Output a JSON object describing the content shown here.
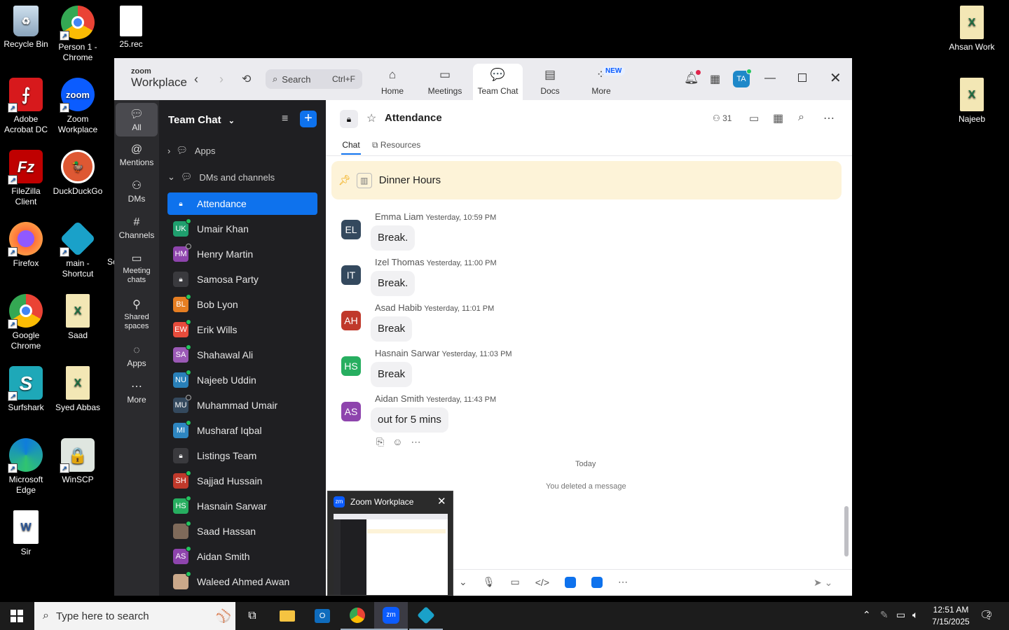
{
  "desktop": {
    "left_icons": [
      {
        "label": "Recycle Bin",
        "icon": "recycle-bin-icon",
        "color": "#9fb4c8"
      },
      {
        "label": "Person 1 - Chrome",
        "icon": "chrome-profile-icon",
        "color": "#34a853"
      },
      {
        "label": "25.rec",
        "icon": "file-icon",
        "color": "#ffffff"
      },
      {
        "label": "Adobe Acrobat DC",
        "icon": "acrobat-icon",
        "color": "#d7191c"
      },
      {
        "label": "Zoom Workplace",
        "icon": "zoom-icon",
        "color": "#0b5cff"
      },
      {
        "label": "FileZilla Client",
        "icon": "filezilla-icon",
        "color": "#bf0000"
      },
      {
        "label": "DuckDuckGo",
        "icon": "duckduckgo-icon",
        "color": "#de5833"
      },
      {
        "label": "Firefox",
        "icon": "firefox-icon",
        "color": "#ff7139"
      },
      {
        "label": "main - Shortcut",
        "icon": "app-shortcut-icon",
        "color": "#1aa1c9"
      },
      {
        "label": "Google Chrome",
        "icon": "chrome-icon",
        "color": "#34a853"
      },
      {
        "label": "Saad",
        "icon": "excel-file-icon",
        "color": "#1d6f42"
      },
      {
        "label": "Surfshark",
        "icon": "surfshark-icon",
        "color": "#1ea8b8"
      },
      {
        "label": "Syed Abbas",
        "icon": "excel-file-icon",
        "color": "#1d6f42"
      },
      {
        "label": "Microsoft Edge",
        "icon": "edge-icon",
        "color": "#0f7ddb"
      },
      {
        "label": "WinSCP",
        "icon": "winscp-icon",
        "color": "#2f8f3a"
      },
      {
        "label": "Sir",
        "icon": "word-file-icon",
        "color": "#2b579a"
      }
    ],
    "right_icons": [
      {
        "label": "Ahsan Work",
        "icon": "excel-file-icon"
      },
      {
        "label": "Najeeb",
        "icon": "excel-file-icon"
      }
    ],
    "partial_label": "Sc"
  },
  "zoom": {
    "logo_top": "zoom",
    "logo_bottom": "Workplace",
    "search_placeholder": "Search",
    "search_shortcut": "Ctrl+F",
    "nav_tabs": [
      {
        "label": "Home",
        "icon": "home-icon"
      },
      {
        "label": "Meetings",
        "icon": "video-icon"
      },
      {
        "label": "Team Chat",
        "icon": "chat-icon"
      },
      {
        "label": "Docs",
        "icon": "docs-icon"
      },
      {
        "label": "More",
        "icon": "more-icon"
      }
    ],
    "new_badge": "NEW",
    "avatar_initials": "TA",
    "rail": [
      {
        "label": "All",
        "icon": "chat-bubble-icon"
      },
      {
        "label": "Mentions",
        "icon": "at-icon"
      },
      {
        "label": "DMs",
        "icon": "people-icon"
      },
      {
        "label": "Channels",
        "icon": "hashtag-icon"
      },
      {
        "label": "Meeting chats",
        "icon": "calendar-icon"
      },
      {
        "label": "Shared spaces",
        "icon": "shared-icon"
      },
      {
        "label": "Apps",
        "icon": "apps-icon"
      },
      {
        "label": "More",
        "icon": "ellipsis-icon"
      }
    ],
    "list_title": "Team Chat",
    "apps_section": "Apps",
    "dms_section": "DMs and channels",
    "channels": [
      {
        "name": "Attendance",
        "initials": "",
        "color": "#0e72ed",
        "type": "locked",
        "status": ""
      },
      {
        "name": "Umair Khan",
        "initials": "UK",
        "color": "#1f9f6e",
        "type": "user",
        "status": "online"
      },
      {
        "name": "Henry Martin",
        "initials": "HM",
        "color": "#8e44ad",
        "type": "user",
        "status": "offline"
      },
      {
        "name": "Samosa Party",
        "initials": "",
        "color": "#3a3a3e",
        "type": "locked",
        "status": ""
      },
      {
        "name": "Bob Lyon",
        "initials": "BL",
        "color": "#e67e22",
        "type": "user",
        "status": "online"
      },
      {
        "name": "Erik Wills",
        "initials": "EW",
        "color": "#e74c3c",
        "type": "user",
        "status": "online"
      },
      {
        "name": "Shahawal Ali",
        "initials": "SA",
        "color": "#9b59b6",
        "type": "user",
        "status": "online"
      },
      {
        "name": "Najeeb Uddin",
        "initials": "NU",
        "color": "#2980b9",
        "type": "user",
        "status": "online"
      },
      {
        "name": "Muhammad Umair",
        "initials": "MU",
        "color": "#34495e",
        "type": "user",
        "status": "offline"
      },
      {
        "name": "Musharaf Iqbal",
        "initials": "MI",
        "color": "#2e86c1",
        "type": "user",
        "status": "online"
      },
      {
        "name": "Listings Team",
        "initials": "",
        "color": "#3a3a3e",
        "type": "locked",
        "status": ""
      },
      {
        "name": "Sajjad Hussain",
        "initials": "SH",
        "color": "#c0392b",
        "type": "user",
        "status": "online"
      },
      {
        "name": "Hasnain Sarwar",
        "initials": "HS",
        "color": "#27ae60",
        "type": "user",
        "status": "online"
      },
      {
        "name": "Saad Hassan",
        "initials": "",
        "color": "#7f6a5a",
        "type": "photo",
        "status": "online"
      },
      {
        "name": "Aidan Smith",
        "initials": "AS",
        "color": "#8e44ad",
        "type": "user",
        "status": "online"
      },
      {
        "name": "Waleed Ahmed Awan",
        "initials": "",
        "color": "#caa88a",
        "type": "photo",
        "status": "online"
      }
    ],
    "chat_title": "Attendance",
    "member_count": "31",
    "chat_tabs": {
      "chat": "Chat",
      "resources": "Resources"
    },
    "pinned": "Dinner Hours",
    "messages": [
      {
        "author": "Emma Liam",
        "time": "Yesterday, 10:59 PM",
        "initials": "EL",
        "color": "#34495e",
        "text": "Break."
      },
      {
        "author": "Izel Thomas",
        "time": "Yesterday, 11:00 PM",
        "initials": "IT",
        "color": "#34495e",
        "text": "Break."
      },
      {
        "author": "Asad Habib",
        "time": "Yesterday, 11:01 PM",
        "initials": "AH",
        "color": "#c0392b",
        "text": "Break"
      },
      {
        "author": "Hasnain Sarwar",
        "time": "Yesterday, 11:03 PM",
        "initials": "HS",
        "color": "#27ae60",
        "text": "Break"
      },
      {
        "author": "Aidan Smith",
        "time": "Yesterday, 11:43 PM",
        "initials": "AS",
        "color": "#8e44ad",
        "text": "out for 5 mins"
      }
    ],
    "today_label": "Today",
    "deleted_label": "You deleted a message",
    "preview_title": "Zoom Workplace",
    "preview_logo": "zm"
  },
  "taskbar": {
    "search_placeholder": "Type here to search",
    "time": "12:51 AM",
    "date": "7/15/2025",
    "notification_count": "2",
    "zoom_label": "zm"
  }
}
